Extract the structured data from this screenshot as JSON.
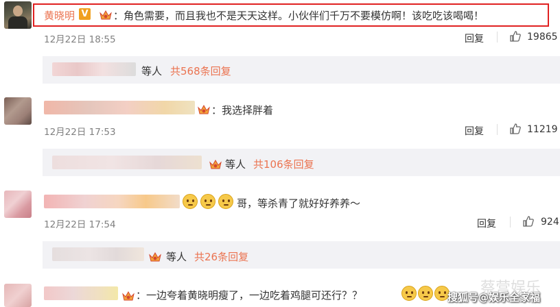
{
  "comments": [
    {
      "name": "黄晓明",
      "verified_badge": "V",
      "text": "：角色需要，而且我也不是天天这样。小伙伴们千万不要模仿啊！该吃吃该喝喝！",
      "time": "12月22日 18:55",
      "reply": "回复",
      "likes": "19865"
    },
    {
      "text": "：我选择胖着",
      "time": "12月22日 17:53",
      "reply": "回复",
      "likes": "11219"
    },
    {
      "text": "哥，等杀青了就好好养养～",
      "time": "12月22日 17:54",
      "reply": "回复",
      "likes": "924"
    },
    {
      "text": "：一边夸着黄晓明瘦了，一边吃着鸡腿可还行？？"
    }
  ],
  "reply_summaries": [
    {
      "prefix": "等人",
      "count": "共568条回复"
    },
    {
      "prefix": "等人",
      "count": "共106条回复"
    },
    {
      "prefix": "等人",
      "count": "共26条回复"
    }
  ],
  "watermark": {
    "faint": "蔡营娱乐",
    "source": "搜狐号@娱乐全家福"
  },
  "colors": {
    "highlight_border": "#e02020",
    "name": "#eb7350",
    "reply_count": "#eb7350",
    "verified": "#f0a020"
  },
  "icons": [
    "thumbs-up-icon",
    "crown-vip-icon",
    "sad-face-emoji",
    "laughing-emoji"
  ]
}
